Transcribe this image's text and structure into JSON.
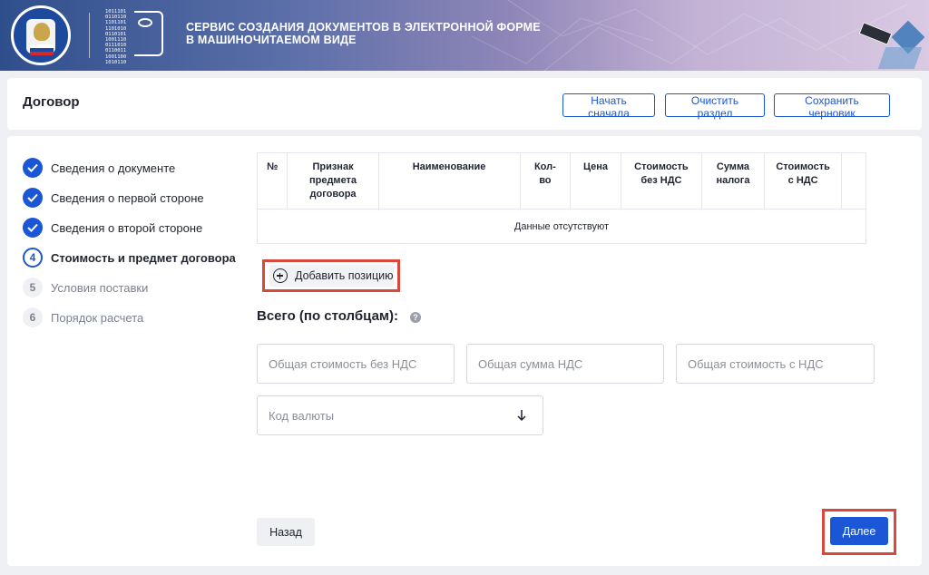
{
  "header": {
    "binary_text": "1011101\n0110110\n1101101\n1101010\n0110101\n1001110\n0111010\n0110011\n1001100\n1010110",
    "title_line1": "СЕРВИС СОЗДАНИЯ ДОКУМЕНТОВ В ЭЛЕКТРОННОЙ ФОРМЕ",
    "title_line2": "В МАШИНОЧИТАЕМОМ ВИДЕ"
  },
  "title_bar": {
    "title": "Договор",
    "buttons": {
      "restart": "Начать сначала",
      "clear": "Очистить раздел",
      "save_draft": "Сохранить черновик"
    }
  },
  "steps": [
    {
      "status": "done",
      "number": "",
      "label": "Сведения о документе"
    },
    {
      "status": "done",
      "number": "",
      "label": "Сведения о первой стороне"
    },
    {
      "status": "done",
      "number": "",
      "label": "Сведения о второй стороне"
    },
    {
      "status": "current",
      "number": "4",
      "label": "Стоимость и предмет договора"
    },
    {
      "status": "todo",
      "number": "5",
      "label": "Условия поставки"
    },
    {
      "status": "todo",
      "number": "6",
      "label": "Порядок расчета"
    }
  ],
  "table": {
    "columns": [
      "№",
      "Признак предмета договора",
      "Наименование",
      "Кол-во",
      "Цена",
      "Стоимость без НДС",
      "Сумма налога",
      "Стоимость с НДС",
      ""
    ],
    "empty_text": "Данные отсутствуют"
  },
  "add_position_label": "Добавить позицию",
  "totals": {
    "title": "Всего (по столбцам):",
    "help": "?",
    "placeholders": {
      "total_no_vat": "Общая стоимость без НДС",
      "total_vat": "Общая сумма НДС",
      "total_with_vat": "Общая стоимость с НДС"
    }
  },
  "currency": {
    "placeholder": "Код валюты"
  },
  "nav": {
    "back": "Назад",
    "next": "Далее"
  },
  "colors": {
    "accent": "#1a56d6",
    "highlight": "#d9483b"
  }
}
